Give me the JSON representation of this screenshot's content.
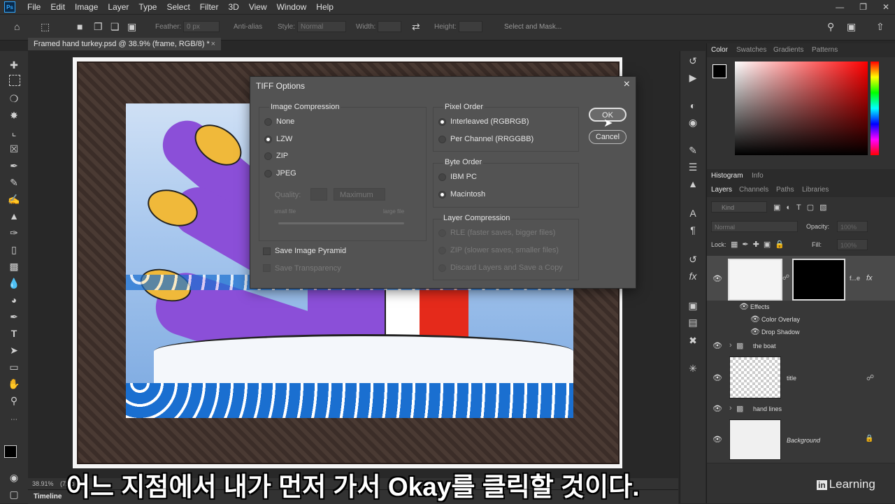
{
  "app": {
    "logo": "Ps"
  },
  "menu": [
    "File",
    "Edit",
    "Image",
    "Layer",
    "Type",
    "Select",
    "Filter",
    "3D",
    "View",
    "Window",
    "Help"
  ],
  "options": {
    "feather_label": "Feather:",
    "feather_value": "0 px",
    "antialias_label": "Anti-alias",
    "style_label": "Style:",
    "style_value": "Normal",
    "width_label": "Width:",
    "height_label": "Height:",
    "select_mask": "Select and Mask..."
  },
  "document": {
    "tab_title": "Framed hand turkey.psd @ 38.9% (frame, RGB/8) *",
    "zoom": "38.91%",
    "status": "(72 p"
  },
  "timeline": "Timeline",
  "dialog": {
    "title": "TIFF Options",
    "image_compression": {
      "title": "Image Compression",
      "options": [
        "None",
        "LZW",
        "ZIP",
        "JPEG"
      ],
      "selected": "LZW",
      "quality_label": "Quality:",
      "quality_value": "Maximum",
      "small_file": "small file",
      "large_file": "large file"
    },
    "pixel_order": {
      "title": "Pixel Order",
      "options": [
        "Interleaved (RGBRGB)",
        "Per Channel (RRGGBB)"
      ],
      "selected": "Interleaved (RGBRGB)"
    },
    "byte_order": {
      "title": "Byte Order",
      "options": [
        "IBM PC",
        "Macintosh"
      ],
      "selected": "Macintosh"
    },
    "layer_compression": {
      "title": "Layer Compression",
      "options": [
        "RLE (faster saves, bigger files)",
        "ZIP (slower saves, smaller files)",
        "Discard Layers and Save a Copy"
      ]
    },
    "save_pyramid": "Save Image Pyramid",
    "save_transparency": "Save Transparency",
    "ok": "OK",
    "cancel": "Cancel"
  },
  "panels": {
    "color_tabs": [
      "Color",
      "Swatches",
      "Gradients",
      "Patterns"
    ],
    "hist_tabs": [
      "Histogram",
      "Info"
    ],
    "layer_tabs": [
      "Layers",
      "Channels",
      "Paths",
      "Libraries"
    ],
    "kind_label": "Kind",
    "blend_mode": "Normal",
    "opacity_label": "Opacity:",
    "opacity_value": "100%",
    "lock_label": "Lock:",
    "fill_label": "Fill:",
    "fill_value": "100%",
    "layers": {
      "frame_name": "f...e",
      "fx": "fx",
      "effects": "Effects",
      "color_overlay": "Color Overlay",
      "drop_shadow": "Drop Shadow",
      "the_boat": "the boat",
      "title": "title",
      "hand_lines": "hand lines",
      "background": "Background"
    }
  },
  "caption": "어느 지점에서 내가 먼저 가서 Okay를 클릭할 것이다.",
  "watermark": {
    "badge": "in",
    "text": "Learning"
  },
  "colors": {
    "accent": "#31a8ff",
    "dialog_bg": "#535353",
    "panel_bg": "#323232"
  }
}
